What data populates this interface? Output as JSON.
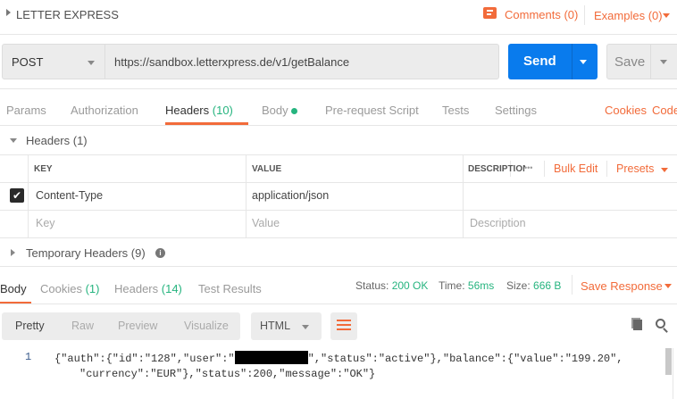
{
  "header": {
    "collection_title": "LETTER EXPRESS",
    "comments_label": "Comments (0)",
    "examples_label": "Examples (0)"
  },
  "request": {
    "method": "POST",
    "url": "https://sandbox.letterxpress.de/v1/getBalance",
    "send_label": "Send",
    "save_label": "Save"
  },
  "request_tabs": {
    "params": "Params",
    "authorization": "Authorization",
    "headers": "Headers",
    "headers_count": "(10)",
    "body": "Body",
    "prerequest": "Pre-request Script",
    "tests": "Tests",
    "settings": "Settings",
    "cookies": "Cookies",
    "code": "Code"
  },
  "headers_section": {
    "title": "Headers (1)",
    "columns": {
      "key": "KEY",
      "value": "VALUE",
      "description": "DESCRIPTION"
    },
    "more": "•••",
    "bulk_edit": "Bulk Edit",
    "presets": "Presets",
    "rows": [
      {
        "checked": true,
        "key": "Content-Type",
        "value": "application/json",
        "description": ""
      }
    ],
    "placeholders": {
      "key": "Key",
      "value": "Value",
      "description": "Description"
    },
    "temporary": "Temporary Headers (9)"
  },
  "response_tabs": {
    "body": "Body",
    "cookies": "Cookies",
    "cookies_count": "(1)",
    "headers": "Headers",
    "headers_count": "(14)",
    "test_results": "Test Results"
  },
  "response_meta": {
    "status_label": "Status:",
    "status": "200 OK",
    "time_label": "Time:",
    "time": "56ms",
    "size_label": "Size:",
    "size": "666 B",
    "save_response": "Save Response"
  },
  "response_toolbar": {
    "pretty": "Pretty",
    "raw": "Raw",
    "preview": "Preview",
    "visualize": "Visualize",
    "format": "HTML"
  },
  "response_body": {
    "line_number": "1",
    "line1_a": "{\"auth\":{\"id\":\"128\",\"user\":\"",
    "line1_b": "\",\"status\":\"active\"},\"balance\":{\"value\":\"199.20\",",
    "line2": "\"currency\":\"EUR\"},\"status\":200,\"message\":\"OK\"}"
  },
  "colors": {
    "accent": "#f26b3a",
    "primary": "#097bed",
    "success": "#26b47f"
  }
}
